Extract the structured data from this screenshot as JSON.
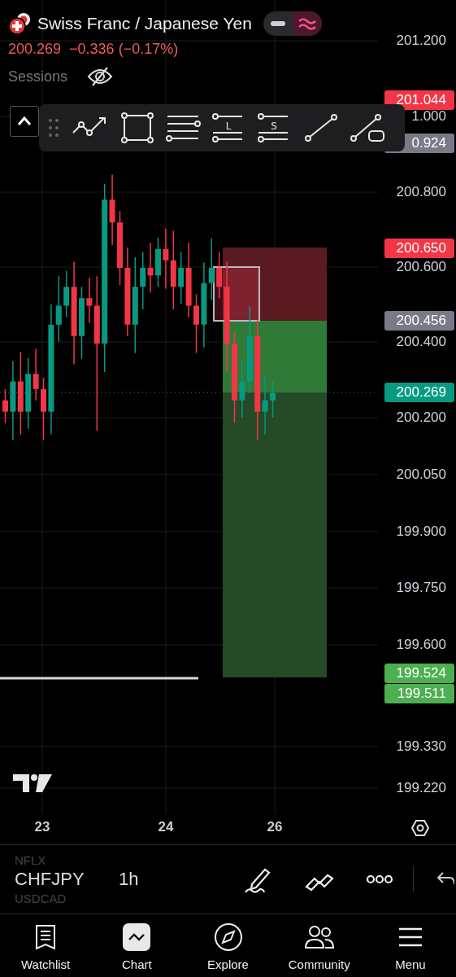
{
  "header": {
    "title": "Swiss Franc / Japanese Yen",
    "price": "200.269",
    "change": "−0.336 (−0.17%)",
    "mode_toggle": [
      {
        "kind": "minus",
        "selected": false
      },
      {
        "kind": "wave",
        "selected": true
      }
    ],
    "sessions": {
      "label": "Sessions",
      "visible": false
    }
  },
  "toolbar": {
    "collapsed": false,
    "tools": [
      {
        "kind": "path"
      },
      {
        "kind": "rectangle"
      },
      {
        "kind": "fib"
      },
      {
        "kind": "long",
        "letter": "L"
      },
      {
        "kind": "short",
        "letter": "S"
      },
      {
        "kind": "line"
      },
      {
        "kind": "callout"
      }
    ]
  },
  "price_axis": {
    "ticks": [
      "201.200",
      "1.000",
      "200.800",
      "200.600",
      "200.400",
      "200.200",
      "200.050",
      "199.900",
      "199.750",
      "199.600",
      "199.330",
      "199.220"
    ],
    "tags": [
      {
        "label": "201.044",
        "color": "#f23645"
      },
      {
        "label": "0.924",
        "color": "#787b86"
      },
      {
        "label": "200.650",
        "color": "#f23645"
      },
      {
        "label": "200.456",
        "color": "#787b86"
      },
      {
        "label": "200.269",
        "color": "#089981"
      },
      {
        "label": "199.524",
        "color": "#4caf50"
      },
      {
        "label": "199.511",
        "color": "#4caf50"
      }
    ]
  },
  "time_axis": [
    "23",
    "24",
    "26"
  ],
  "symbol_bar": {
    "previous": "NFLX",
    "symbol": "CHFJPY",
    "next": "USDCAD",
    "interval": "1h"
  },
  "tab_bar": [
    {
      "label": "Watchlist",
      "kind": "watchlist",
      "selected": false
    },
    {
      "label": "Chart",
      "kind": "chart",
      "selected": true
    },
    {
      "label": "Explore",
      "kind": "explore",
      "selected": false
    },
    {
      "label": "Community",
      "kind": "community",
      "selected": false
    },
    {
      "label": "Menu",
      "kind": "menu",
      "selected": false
    }
  ]
}
